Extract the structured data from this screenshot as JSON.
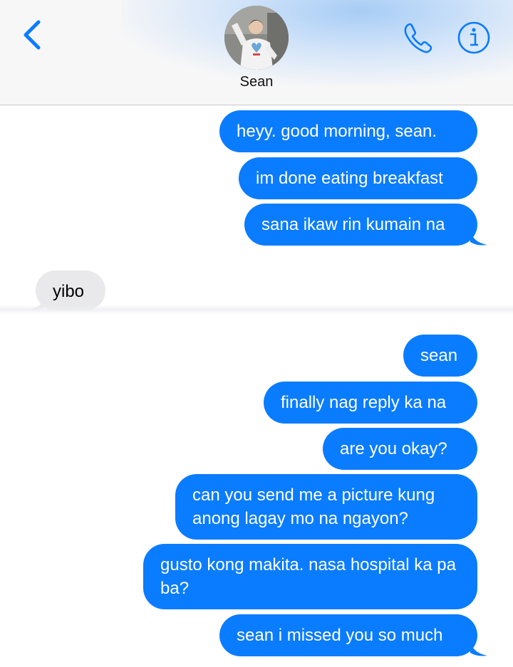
{
  "header": {
    "contact_name": "Sean",
    "icons": {
      "back": "chevron-left-icon",
      "phone": "phone-icon",
      "info": "info-icon",
      "avatar": "contact-avatar"
    },
    "accent_color": "#0a7cff"
  },
  "messages": [
    {
      "direction": "outgoing",
      "text": "heyy. good morning, sean."
    },
    {
      "direction": "outgoing",
      "text": "im done eating breakfast"
    },
    {
      "direction": "outgoing",
      "text": "sana ikaw rin kumain na"
    },
    {
      "direction": "incoming",
      "text": "yibo"
    },
    {
      "direction": "outgoing",
      "text": "sean"
    },
    {
      "direction": "outgoing",
      "text": "finally nag reply ka na"
    },
    {
      "direction": "outgoing",
      "text": "are you okay?"
    },
    {
      "direction": "outgoing",
      "text": "can you send me a picture kung anong lagay mo na ngayon?"
    },
    {
      "direction": "outgoing",
      "text": "gusto kong makita. nasa hospital ka pa ba?"
    },
    {
      "direction": "outgoing",
      "text": "sean i missed you so much"
    }
  ],
  "colors": {
    "outgoing_bubble": "#0a7cff",
    "incoming_bubble": "#e9e9eb"
  }
}
